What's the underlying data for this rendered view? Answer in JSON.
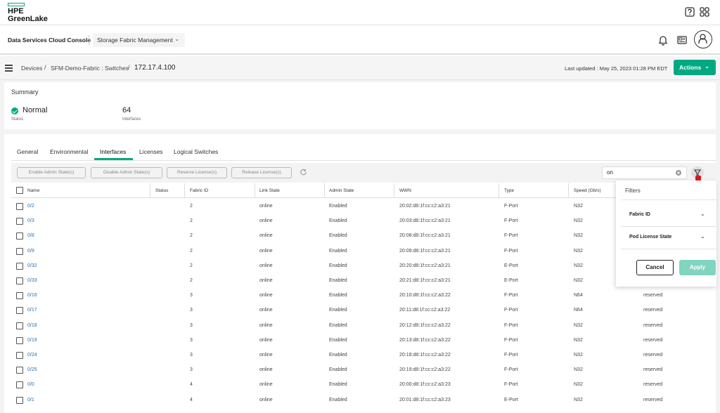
{
  "brand": {
    "line1": "HPE",
    "line2": "GreenLake"
  },
  "console": {
    "title": "Data Services Cloud Console",
    "app_select": "Storage Fabric Management"
  },
  "breadcrumb": {
    "items": [
      "Devices",
      "SFM-Demo-Fabric : Switches",
      "172.17.4.100"
    ]
  },
  "last_updated": "Last updated :  May 25, 2023 01:28 PM EDT",
  "actions_label": "Actions",
  "summary": {
    "title": "Summary",
    "status_value": "Normal",
    "status_label": "Status",
    "interfaces_value": "64",
    "interfaces_label": "Interfaces"
  },
  "tabs": [
    "General",
    "Environmental",
    "Interfaces",
    "Licenses",
    "Logical Switches"
  ],
  "active_tab": "Interfaces",
  "toolbar": {
    "buttons": [
      "Enable Admin State(s)",
      "Disable Admin State(s)",
      "Reserve License(s)",
      "Release License(s)"
    ],
    "search_value": "on"
  },
  "table": {
    "columns": [
      "Name",
      "Status",
      "Fabric ID",
      "Link State",
      "Admin State",
      "WWN",
      "Type",
      "Speed (Gb/s)"
    ],
    "rows": [
      {
        "name": "0/2",
        "status": "",
        "fabric": "2",
        "link": "online",
        "admin": "Enabled",
        "wwn": "20:02:d8:1f:cc:c2:a3:21",
        "type": "F-Port",
        "speed": "N32",
        "license": ""
      },
      {
        "name": "0/3",
        "status": "",
        "fabric": "2",
        "link": "online",
        "admin": "Enabled",
        "wwn": "20:03:d8:1f:cc:c2:a3:21",
        "type": "F-Port",
        "speed": "N32",
        "license": ""
      },
      {
        "name": "0/8",
        "status": "",
        "fabric": "2",
        "link": "online",
        "admin": "Enabled",
        "wwn": "20:08:d8:1f:cc:c2:a3:21",
        "type": "F-Port",
        "speed": "N32",
        "license": ""
      },
      {
        "name": "0/9",
        "status": "",
        "fabric": "2",
        "link": "online",
        "admin": "Enabled",
        "wwn": "20:09:d8:1f:cc:c2:a3:21",
        "type": "F-Port",
        "speed": "N32",
        "license": ""
      },
      {
        "name": "0/32",
        "status": "",
        "fabric": "2",
        "link": "online",
        "admin": "Enabled",
        "wwn": "20:20:d8:1f:cc:c2:a3:21",
        "type": "E-Port",
        "speed": "N32",
        "license": ""
      },
      {
        "name": "0/33",
        "status": "",
        "fabric": "2",
        "link": "online",
        "admin": "Enabled",
        "wwn": "20:21:d8:1f:cc:c2:a3:21",
        "type": "E-Port",
        "speed": "N32",
        "license": ""
      },
      {
        "name": "0/16",
        "status": "",
        "fabric": "3",
        "link": "online",
        "admin": "Enabled",
        "wwn": "20:10:d8:1f:cc:c2:a3:22",
        "type": "F-Port",
        "speed": "N64",
        "license": "reserved"
      },
      {
        "name": "0/17",
        "status": "",
        "fabric": "3",
        "link": "online",
        "admin": "Enabled",
        "wwn": "20:11:d8:1f:cc:c2:a3:22",
        "type": "F-Port",
        "speed": "N64",
        "license": "reserved"
      },
      {
        "name": "0/18",
        "status": "",
        "fabric": "3",
        "link": "online",
        "admin": "Enabled",
        "wwn": "20:12:d8:1f:cc:c2:a3:22",
        "type": "F-Port",
        "speed": "N32",
        "license": "reserved"
      },
      {
        "name": "0/19",
        "status": "",
        "fabric": "3",
        "link": "online",
        "admin": "Enabled",
        "wwn": "20:13:d8:1f:cc:c2:a3:22",
        "type": "F-Port",
        "speed": "N32",
        "license": "reserved"
      },
      {
        "name": "0/24",
        "status": "",
        "fabric": "3",
        "link": "online",
        "admin": "Enabled",
        "wwn": "20:18:d8:1f:cc:c2:a3:22",
        "type": "F-Port",
        "speed": "N32",
        "license": "reserved"
      },
      {
        "name": "0/25",
        "status": "",
        "fabric": "3",
        "link": "online",
        "admin": "Enabled",
        "wwn": "20:19:d8:1f:cc:c2:a3:22",
        "type": "F-Port",
        "speed": "N32",
        "license": "reserved"
      },
      {
        "name": "0/0",
        "status": "",
        "fabric": "4",
        "link": "online",
        "admin": "Enabled",
        "wwn": "20:00:d8:1f:cc:c2:a3:23",
        "type": "F-Port",
        "speed": "N32",
        "license": "reserved"
      },
      {
        "name": "0/1",
        "status": "",
        "fabric": "4",
        "link": "online",
        "admin": "Enabled",
        "wwn": "20:01:d8:1f:cc:c2:a3:23",
        "type": "E-Port",
        "speed": "N32",
        "license": "reserved"
      }
    ]
  },
  "filters": {
    "title": "Filters",
    "items": [
      "Fabric ID",
      "Pod License State"
    ],
    "cancel_label": "Cancel",
    "apply_label": "Apply"
  },
  "colors": {
    "accent": "#01a982",
    "link": "#2a6fb0",
    "apply_disabled": "#80d4c0"
  },
  "icons": [
    "help-icon",
    "apps-grid-icon",
    "bell-icon",
    "newspaper-icon",
    "user-avatar-icon",
    "menu-icon",
    "refresh-icon",
    "clear-icon",
    "filter-icon",
    "chevron-down-icon",
    "status-ok-icon"
  ]
}
